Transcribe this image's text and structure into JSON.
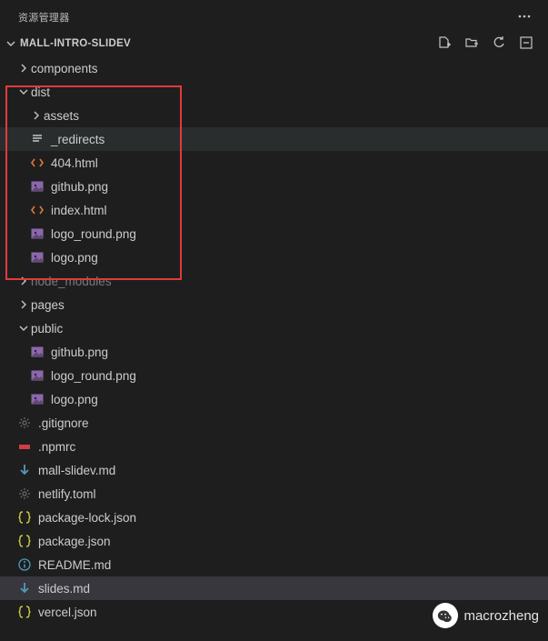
{
  "header": {
    "title": "资源管理器"
  },
  "project": {
    "name": "MALL-INTRO-SLIDEV"
  },
  "tree": [
    {
      "type": "folder",
      "state": "collapsed",
      "indent": 1,
      "label": "components",
      "icon": "chevron-right"
    },
    {
      "type": "folder",
      "state": "expanded",
      "indent": 1,
      "label": "dist",
      "icon": "chevron-down"
    },
    {
      "type": "folder",
      "state": "collapsed",
      "indent": 2,
      "label": "assets",
      "icon": "chevron-right"
    },
    {
      "type": "file",
      "indent": 2,
      "label": "_redirects",
      "icon": "lines",
      "iconColor": "c-light",
      "hovered": true
    },
    {
      "type": "file",
      "indent": 2,
      "label": "404.html",
      "icon": "code",
      "iconColor": "c-orange"
    },
    {
      "type": "file",
      "indent": 2,
      "label": "github.png",
      "icon": "image",
      "iconColor": "c-purple"
    },
    {
      "type": "file",
      "indent": 2,
      "label": "index.html",
      "icon": "code",
      "iconColor": "c-orange"
    },
    {
      "type": "file",
      "indent": 2,
      "label": "logo_round.png",
      "icon": "image",
      "iconColor": "c-purple"
    },
    {
      "type": "file",
      "indent": 2,
      "label": "logo.png",
      "icon": "image",
      "iconColor": "c-purple"
    },
    {
      "type": "folder",
      "state": "collapsed",
      "indent": 1,
      "label": "node_modules",
      "icon": "chevron-right",
      "muted": true
    },
    {
      "type": "folder",
      "state": "collapsed",
      "indent": 1,
      "label": "pages",
      "icon": "chevron-right"
    },
    {
      "type": "folder",
      "state": "expanded",
      "indent": 1,
      "label": "public",
      "icon": "chevron-down"
    },
    {
      "type": "file",
      "indent": 2,
      "label": "github.png",
      "icon": "image",
      "iconColor": "c-purple"
    },
    {
      "type": "file",
      "indent": 2,
      "label": "logo_round.png",
      "icon": "image",
      "iconColor": "c-purple"
    },
    {
      "type": "file",
      "indent": 2,
      "label": "logo.png",
      "icon": "image",
      "iconColor": "c-purple"
    },
    {
      "type": "file",
      "indent": 1,
      "label": ".gitignore",
      "icon": "gear",
      "iconColor": "c-gray"
    },
    {
      "type": "file",
      "indent": 1,
      "label": ".npmrc",
      "icon": "npm",
      "iconColor": "c-red"
    },
    {
      "type": "file",
      "indent": 1,
      "label": "mall-slidev.md",
      "icon": "arrow-down",
      "iconColor": "c-blue"
    },
    {
      "type": "file",
      "indent": 1,
      "label": "netlify.toml",
      "icon": "gear",
      "iconColor": "c-gray"
    },
    {
      "type": "file",
      "indent": 1,
      "label": "package-lock.json",
      "icon": "braces",
      "iconColor": "c-yellow"
    },
    {
      "type": "file",
      "indent": 1,
      "label": "package.json",
      "icon": "braces",
      "iconColor": "c-yellow"
    },
    {
      "type": "file",
      "indent": 1,
      "label": "README.md",
      "icon": "info",
      "iconColor": "c-blue"
    },
    {
      "type": "file",
      "indent": 1,
      "label": "slides.md",
      "icon": "arrow-down",
      "iconColor": "c-blue",
      "selected": true
    },
    {
      "type": "file",
      "indent": 1,
      "label": "vercel.json",
      "icon": "braces",
      "iconColor": "c-yellow"
    }
  ],
  "watermark": {
    "text": "macrozheng"
  }
}
